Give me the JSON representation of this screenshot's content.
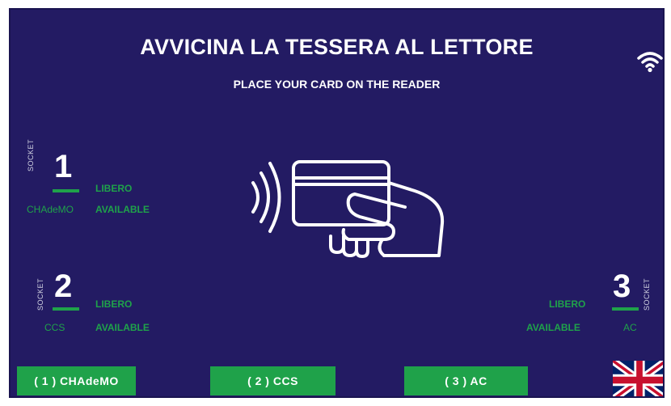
{
  "header": {
    "title": "AVVICINA LA TESSERA AL LETTORE",
    "subtitle": "PLACE YOUR CARD ON THE READER",
    "status_icon": "wifi-icon"
  },
  "sockets": [
    {
      "socket_word": "SOCKET",
      "number": "1",
      "status_it": "LIBERO",
      "status_en": "AVAILABLE",
      "type": "CHAdeMO"
    },
    {
      "socket_word": "SOCKET",
      "number": "2",
      "status_it": "LIBERO",
      "status_en": "AVAILABLE",
      "type": "CCS"
    },
    {
      "socket_word": "SOCKET",
      "number": "3",
      "status_it": "LIBERO",
      "status_en": "AVAILABLE",
      "type": "AC"
    }
  ],
  "center_graphic": "card-reader-icon",
  "buttons": [
    {
      "label": "( 1 ) CHAdeMO"
    },
    {
      "label": "( 2 ) CCS"
    },
    {
      "label": "( 3 ) AC"
    }
  ],
  "language": {
    "icon": "uk-flag-icon"
  },
  "colors": {
    "background": "#231b63",
    "accent_green": "#1fa24a",
    "text": "#ffffff"
  }
}
